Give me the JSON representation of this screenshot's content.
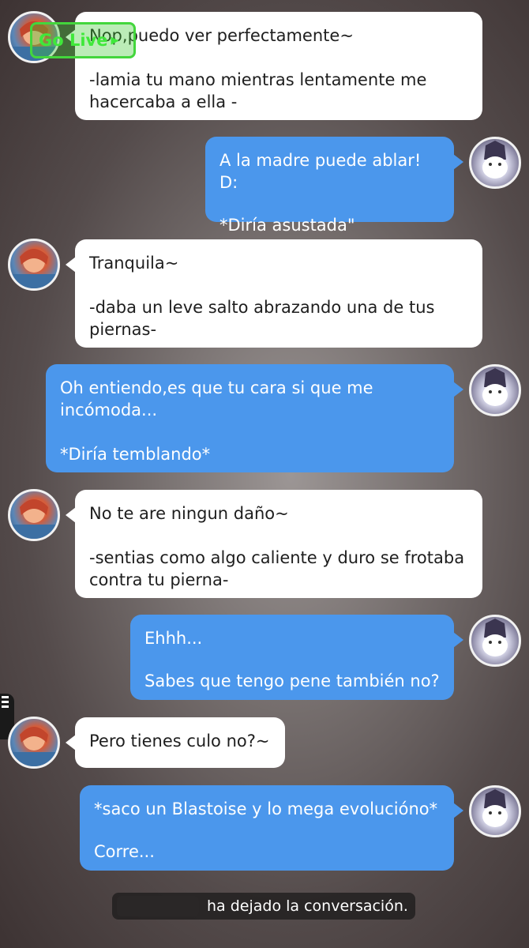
{
  "overlay": {
    "go_live_label": "Go Live"
  },
  "messages": [
    {
      "side": "in",
      "text1": "Nop,puedo ver perfectamente~",
      "text2": "-lamia tu mano mientras lentamente me hacercaba a ella -"
    },
    {
      "side": "out",
      "text1": "A la madre puede ablar! D:",
      "text2": "*Diría asustada\""
    },
    {
      "side": "in",
      "text1": "Tranquila~",
      "text2": "-daba un leve salto abrazando una de tus piernas-"
    },
    {
      "side": "out",
      "text1": "Oh entiendo,es que tu cara si que me incómoda...",
      "text2": "*Diría temblando*"
    },
    {
      "side": "in",
      "text1": "No te are ningun daño~",
      "text2": "-sentias como algo caliente y duro se frotaba contra tu pierna-"
    },
    {
      "side": "out",
      "text1": "Ehhh...",
      "text2": "Sabes que tengo pene también no?"
    },
    {
      "side": "in",
      "text1": "Pero tienes culo no?~"
    },
    {
      "side": "out",
      "text1": "*saco un Blastoise y lo mega evolucióno*",
      "text2": "Corre..."
    }
  ],
  "system_message": {
    "text": "ha dejado la conversación."
  },
  "colors": {
    "incoming_bubble": "#ffffff",
    "outgoing_bubble": "#4b97ec",
    "go_live_accent": "#43d63c"
  }
}
